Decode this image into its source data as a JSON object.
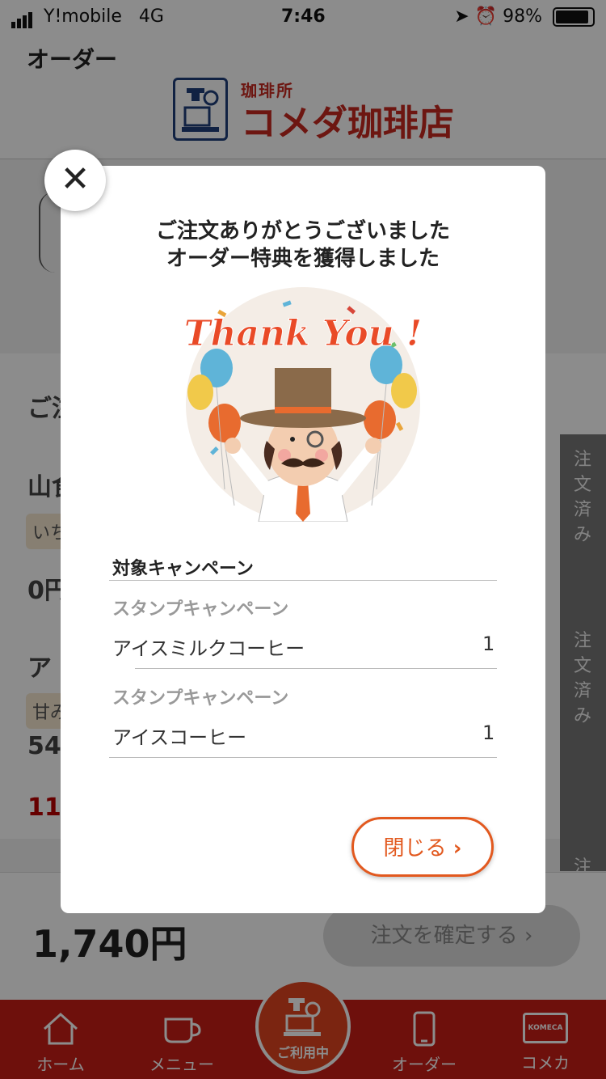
{
  "status_bar": {
    "carrier": "Y!mobile",
    "network": "4G",
    "time": "7:46",
    "battery": "98%"
  },
  "header": {
    "title": "オーダー",
    "logo_small": "珈琲所",
    "logo_big": "コメダ珈琲店"
  },
  "background": {
    "section_heading": "ご注",
    "item1_name": "山食",
    "item1_chip": "いち",
    "item1_price": "0円",
    "item2_name": "ア",
    "item2_chip": "甘み",
    "item2_price": "54",
    "item2_sub": "11",
    "side_tab_1": "注文済み",
    "side_tab_2": "注文済み",
    "side_tab_3": "注"
  },
  "total_bar": {
    "amount": "1,740円",
    "confirm_label": "注文を確定する"
  },
  "tabbar": {
    "home": "ホーム",
    "menu": "メニュー",
    "center": "ご利用中",
    "order": "オーダー",
    "komeca": "コメカ",
    "komeca_card": "KOMECA"
  },
  "modal": {
    "heading_line1": "ご注文ありがとうございました",
    "heading_line2": "オーダー特典を獲得しました",
    "illustration_text": "Thank You !",
    "campaign_section_title": "対象キャンペーン",
    "campaigns": [
      {
        "label": "スタンプキャンペーン",
        "item": "アイスミルクコーヒー",
        "qty": "1"
      },
      {
        "label": "スタンプキャンペーン",
        "item": "アイスコーヒー",
        "qty": "1"
      }
    ],
    "close_label": "閉じる"
  },
  "colors": {
    "brand_red": "#c91e16",
    "accent_orange": "#e2591f"
  }
}
